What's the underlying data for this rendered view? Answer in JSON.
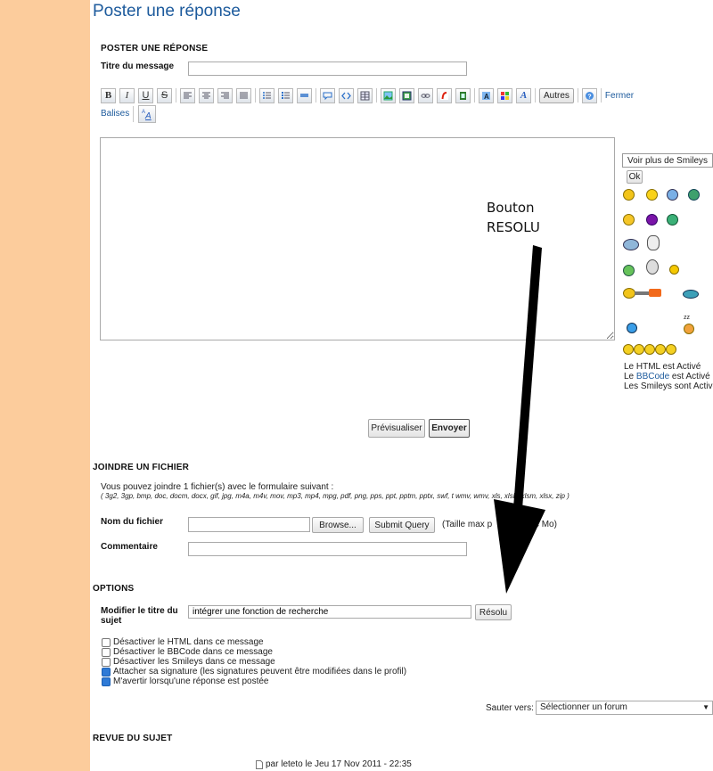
{
  "page": {
    "title": "Poster une réponse"
  },
  "post": {
    "section": "POSTER UNE RÉPONSE",
    "title_label": "Titre du message",
    "title_value": "",
    "toolbar": {
      "buttons": [
        "B",
        "I",
        "U",
        "S"
      ],
      "autres": "Autres",
      "fermer": "Fermer",
      "balises": "Balises"
    },
    "message_value": ""
  },
  "smileys": {
    "select": "Voir plus de Smileys",
    "ok": "Ok",
    "html_status": "Le HTML est Activé",
    "bbcode_prefix": "Le ",
    "bbcode_link": "BBCode",
    "bbcode_suffix": " est Activé",
    "smileys_status": "Les Smileys sont Activés"
  },
  "annotation": {
    "line1": "Bouton",
    "line2": "RESOLU"
  },
  "actions": {
    "preview": "Prévisualiser",
    "send": "Envoyer"
  },
  "attach": {
    "section": "JOINDRE UN FICHIER",
    "info": "Vous pouvez joindre 1 fichier(s) avec le formulaire suivant :",
    "extensions": "( 3g2, 3gp, bmp, doc, docm, docx, gif, jpg, m4a, m4v, mov, mp3, mp4, mpg, pdf, png, pps, ppt, pptm, pptx, swf, t  wmv, wmv, xls, xlsb, xlsm, xlsx, zip )",
    "file_label": "Nom du fichier",
    "browse": "Browse...",
    "submit": "Submit Query",
    "max_size": "(Taille max p          0.244 Mo)",
    "comment_label": "Commentaire",
    "comment_value": ""
  },
  "options": {
    "section": "OPTIONS",
    "modify_label_1": "Modifier le titre du",
    "modify_label_2": "sujet",
    "topic_title": "intégrer une fonction de recherche",
    "resolved": "Résolu",
    "checkboxes": [
      {
        "label": "Désactiver le HTML dans ce message",
        "checked": false
      },
      {
        "label": "Désactiver le BBCode dans ce message",
        "checked": false
      },
      {
        "label": "Désactiver les Smileys dans ce message",
        "checked": false
      },
      {
        "label": "Attacher sa signature (les signatures peuvent être modifiées dans le profil)",
        "checked": true
      },
      {
        "label": "M'avertir lorsqu'une réponse est postée",
        "checked": true
      }
    ],
    "jump_label": "Sauter vers:",
    "jump_value": "Sélectionner un forum"
  },
  "review": {
    "section": "REVUE DU SUJET",
    "post_meta": "par leteto le Jeu 17 Nov 2011 - 22:35"
  },
  "colors": {
    "sidebar": "#fccc9c",
    "title": "#1c5a9c",
    "arrow": "#000000"
  }
}
